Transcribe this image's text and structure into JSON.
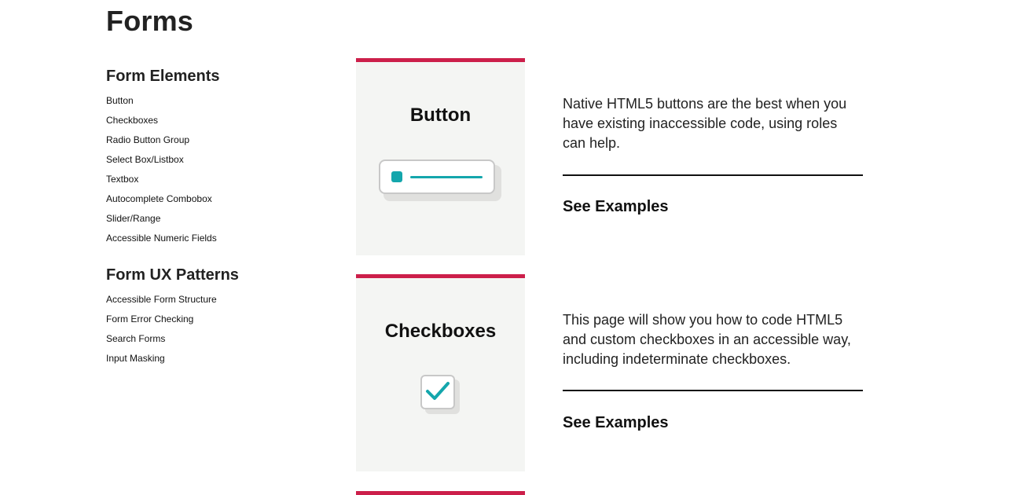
{
  "page": {
    "title": "Forms"
  },
  "sidebar": {
    "groups": [
      {
        "heading": "Form Elements",
        "items": [
          {
            "label": "Button"
          },
          {
            "label": "Checkboxes"
          },
          {
            "label": "Radio Button Group"
          },
          {
            "label": "Select Box/Listbox"
          },
          {
            "label": "Textbox"
          },
          {
            "label": "Autocomplete Combobox"
          },
          {
            "label": "Slider/Range"
          },
          {
            "label": "Accessible Numeric Fields"
          }
        ]
      },
      {
        "heading": "Form UX Patterns",
        "items": [
          {
            "label": "Accessible Form Structure"
          },
          {
            "label": "Form Error Checking"
          },
          {
            "label": "Search Forms"
          },
          {
            "label": "Input Masking"
          }
        ]
      }
    ]
  },
  "cards": [
    {
      "title": "Button",
      "icon": "button-illustration-icon",
      "description": "Native HTML5 buttons are the best when you have existing inaccessible code, using roles can help.",
      "link_label": "See Examples"
    },
    {
      "title": "Checkboxes",
      "icon": "checkbox-checked-icon",
      "description": "This page will show you how to code HTML5 and custom checkboxes in an accessible way, including indeterminate checkboxes.",
      "link_label": "See Examples"
    }
  ],
  "colors": {
    "accent_bar": "#cc1f4a",
    "illustration_teal": "#14a6ac",
    "tile_background": "#f4f5f3"
  }
}
